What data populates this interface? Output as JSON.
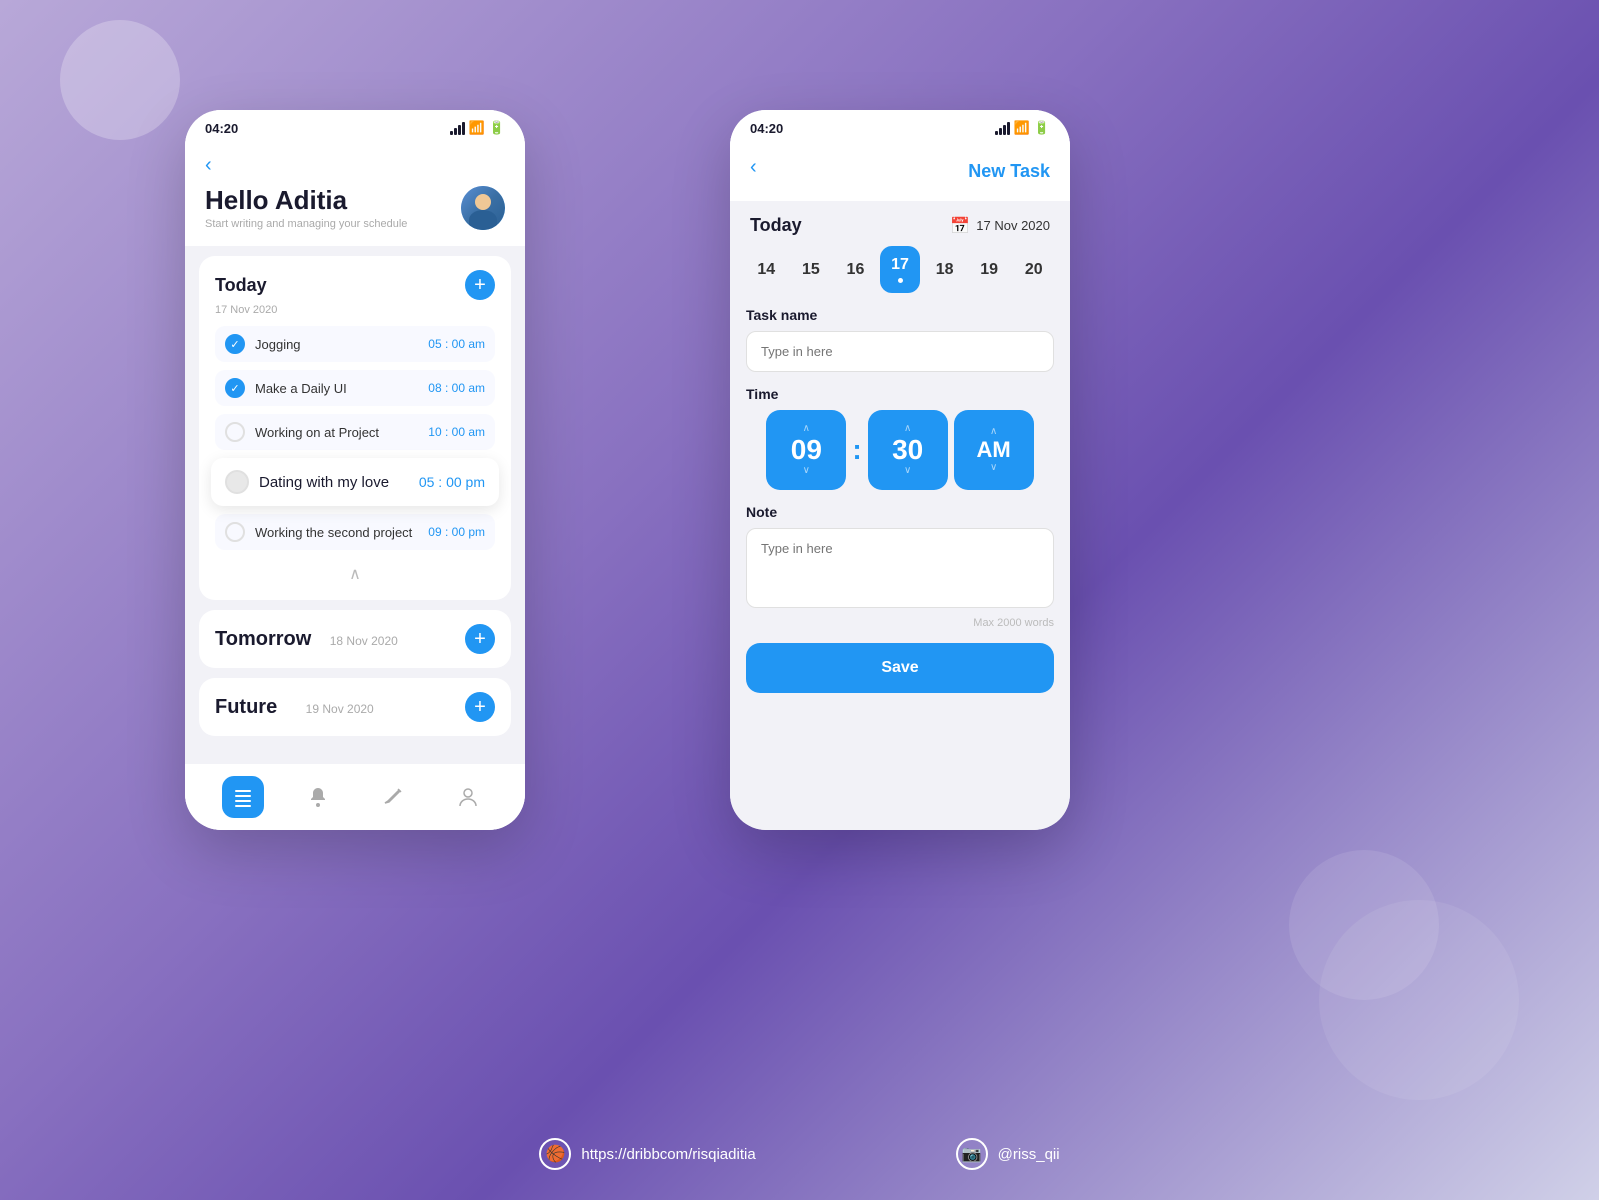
{
  "background": "#8870c0",
  "left_phone": {
    "status_time": "04:20",
    "header": {
      "hello": "Hello Aditia",
      "subtitle": "Start writing and managing your schedule"
    },
    "today": {
      "title": "Today",
      "date": "17 Nov 2020",
      "tasks": [
        {
          "name": "Jogging",
          "time": "05 : 00 am",
          "checked": true
        },
        {
          "name": "Make a Daily UI",
          "time": "08 : 00 am",
          "checked": true
        },
        {
          "name": "Working on at Project",
          "time": "10 : 00 am",
          "checked": false
        },
        {
          "name": "Dating with my love",
          "time": "05 : 00 pm",
          "highlighted": true
        },
        {
          "name": "Working the second project",
          "time": "09 : 00 pm",
          "checked": false
        }
      ]
    },
    "tomorrow": {
      "title": "Tomorrow",
      "date": "18 Nov 2020"
    },
    "future": {
      "title": "Future",
      "date": "19 Nov 2020"
    },
    "nav": {
      "items": [
        "list",
        "bell",
        "pen",
        "user"
      ]
    }
  },
  "right_phone": {
    "status_time": "04:20",
    "title": "New Task",
    "today_label": "Today",
    "date_display": "17 Nov 2020",
    "calendar": {
      "days": [
        14,
        15,
        16,
        17,
        18,
        19,
        20
      ],
      "active_day": 17
    },
    "task_name_label": "Task name",
    "task_name_placeholder": "Type in here",
    "time_label": "Time",
    "time": {
      "hours": "09",
      "minutes": "30",
      "period": "AM"
    },
    "note_label": "Note",
    "note_placeholder": "Type in here",
    "note_hint": "Max 2000 words",
    "save_btn": "Save"
  },
  "footer": {
    "dribbble_url": "https://dribbcom/risqiaditia",
    "instagram": "@riss_qii"
  }
}
